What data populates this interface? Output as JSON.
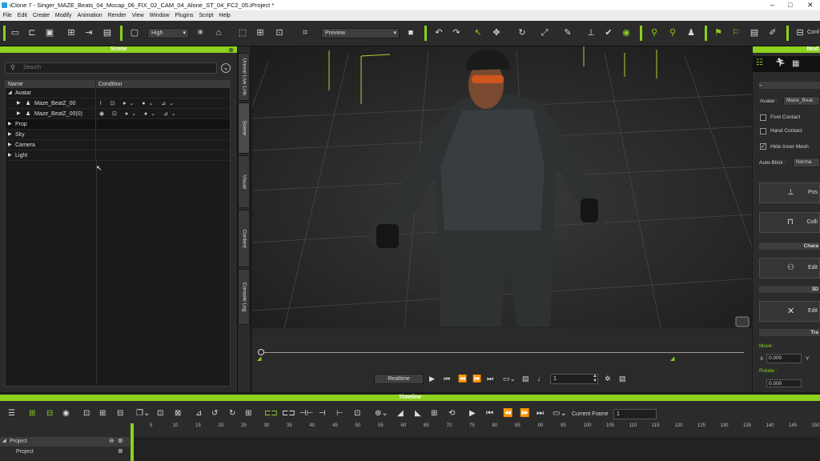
{
  "title": "iClone 7 - Singer_MAZE_Beats_04_Mocap_06_FIX_02_CAM_04_Alone_ST_04_FC2_05.iProject *",
  "menu": [
    "File",
    "Edit",
    "Create",
    "Modify",
    "Animation",
    "Render",
    "View",
    "Window",
    "Plugins",
    "Script",
    "Help"
  ],
  "toolbar": {
    "quality": "High",
    "render_mode": "Preview",
    "conform_label": "Conf"
  },
  "scene": {
    "title": "Scene",
    "search_placeholder": "Search",
    "col_name": "Name",
    "col_condition": "Condition",
    "rows": [
      {
        "label": "Avatar"
      },
      {
        "label": "Maze_BeatZ_00"
      },
      {
        "label": "Maze_BeatZ_00(0)"
      },
      {
        "label": "Prop"
      },
      {
        "label": "Sky"
      },
      {
        "label": "Camera"
      },
      {
        "label": "Light"
      }
    ]
  },
  "vtabs": [
    "Unreal Live Link",
    "Scene",
    "Visual",
    "Content",
    "Console Log"
  ],
  "play": {
    "mode": "Realtime",
    "frame": "1"
  },
  "right": {
    "header": "Mod",
    "avatar_label": "Avatar :",
    "avatar_value": "Maze_Beat",
    "foot_contact": "Foot Contact",
    "hand_contact": "Hand Contact",
    "hide_inner_mesh": "Hide Inner Mesh",
    "auto_blink_label": "Auto-Blink :",
    "auto_blink_value": "Norma",
    "btn_pose": "Pos",
    "btn_coll": "Colli",
    "sec_chara": "Chara",
    "btn_edit1": "Edit",
    "sec_3d": "3D",
    "btn_edit2": "Edit",
    "sec_tra": "Tra",
    "move_label": "Move :",
    "move_x_label": "X",
    "move_x": "0.000",
    "move_y_label": "Y",
    "rotate_label": "Rotate :",
    "rotate_x": "0.000"
  },
  "timeline": {
    "title": "Timeline",
    "current_frame_label": "Current Frame",
    "current_frame": "1",
    "ticks": [
      "5",
      "10",
      "15",
      "20",
      "25",
      "30",
      "35",
      "40",
      "45",
      "50",
      "55",
      "60",
      "65",
      "70",
      "75",
      "80",
      "85",
      "90",
      "95",
      "100",
      "105",
      "110",
      "115",
      "120",
      "125",
      "130",
      "135",
      "140",
      "145",
      "150"
    ],
    "tracks": [
      {
        "label": "Project"
      },
      {
        "label": "Project"
      }
    ]
  }
}
